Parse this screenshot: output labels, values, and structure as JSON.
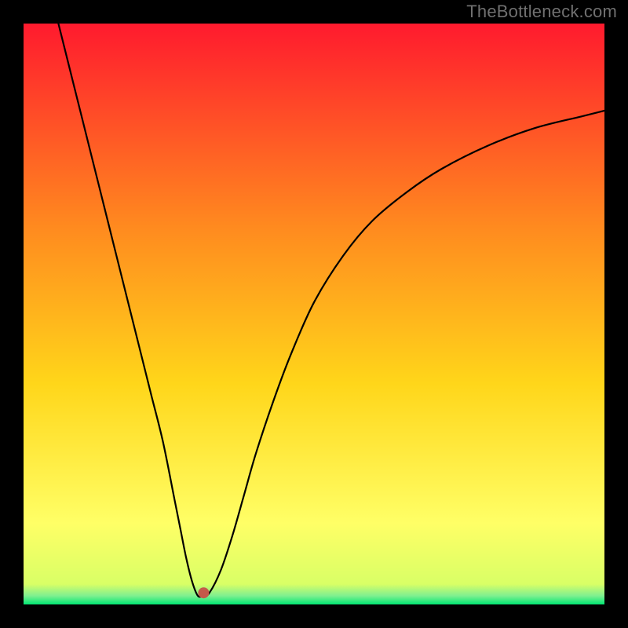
{
  "watermark": "TheBottleneck.com",
  "chart_data": {
    "type": "line",
    "title": "",
    "xlabel": "",
    "ylabel": "",
    "xlim": [
      0,
      100
    ],
    "ylim": [
      0,
      100
    ],
    "background_gradient": {
      "top": "#ff1a2e",
      "mid_upper": "#ff8a1f",
      "mid": "#ffd61a",
      "mid_lower": "#ffff66",
      "bottom": "#00e672"
    },
    "minimum_point": {
      "x": 30,
      "y": 1.5
    },
    "marker": {
      "x": 31,
      "y": 2,
      "color": "#c45a4a",
      "radius": 7
    },
    "series": [
      {
        "name": "curve",
        "stroke": "#000000",
        "stroke_width": 2.2,
        "x": [
          6,
          8,
          10,
          12,
          14,
          16,
          18,
          20,
          22,
          24,
          26,
          27,
          28,
          29,
          30,
          31,
          32,
          34,
          36,
          38,
          40,
          43,
          46,
          50,
          55,
          60,
          66,
          72,
          80,
          88,
          96,
          100
        ],
        "y": [
          100,
          92,
          84,
          76,
          68,
          60,
          52,
          44,
          36,
          28,
          18,
          13,
          8,
          4,
          1.5,
          1.5,
          2,
          6,
          12,
          19,
          26,
          35,
          43,
          52,
          60,
          66,
          71,
          75,
          79,
          82,
          84,
          85
        ]
      }
    ]
  }
}
